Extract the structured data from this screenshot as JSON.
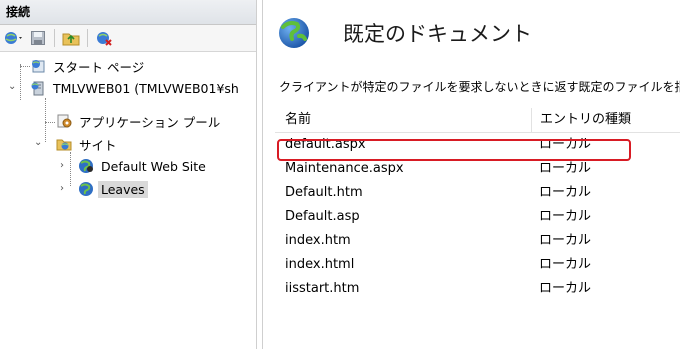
{
  "connections": {
    "title": "接続",
    "toolbar": [
      "connect-icon",
      "save-icon",
      "folder-up-icon",
      "disconnect-icon"
    ],
    "tree": [
      {
        "label": "スタート ページ",
        "icon": "start-page-icon"
      },
      {
        "label": "TMLVWEB01 (TMLVWEB01¥sh",
        "icon": "server-icon"
      },
      {
        "label": "アプリケーション プール",
        "icon": "app-pool-icon"
      },
      {
        "label": "サイト",
        "icon": "sites-folder-icon"
      },
      {
        "label": "Default Web Site",
        "icon": "globe-icon"
      },
      {
        "label": "Leaves",
        "icon": "globe-icon",
        "selected": true
      }
    ]
  },
  "main": {
    "title": "既定のドキュメント",
    "description": "クライアントが特定のファイルを要求しないときに返す既定のファイルを指",
    "columns": {
      "name": "名前",
      "entry_type": "エントリの種類"
    },
    "rows": [
      {
        "name": "default.aspx",
        "type": "ローカル"
      },
      {
        "name": "Maintenance.aspx",
        "type": "ローカル"
      },
      {
        "name": "Default.htm",
        "type": "ローカル"
      },
      {
        "name": "Default.asp",
        "type": "ローカル"
      },
      {
        "name": "index.htm",
        "type": "ローカル"
      },
      {
        "name": "index.html",
        "type": "ローカル"
      },
      {
        "name": "iisstart.htm",
        "type": "ローカル"
      }
    ]
  },
  "colors": {
    "highlight": "#d81b24",
    "selection": "#d9d9d9"
  }
}
